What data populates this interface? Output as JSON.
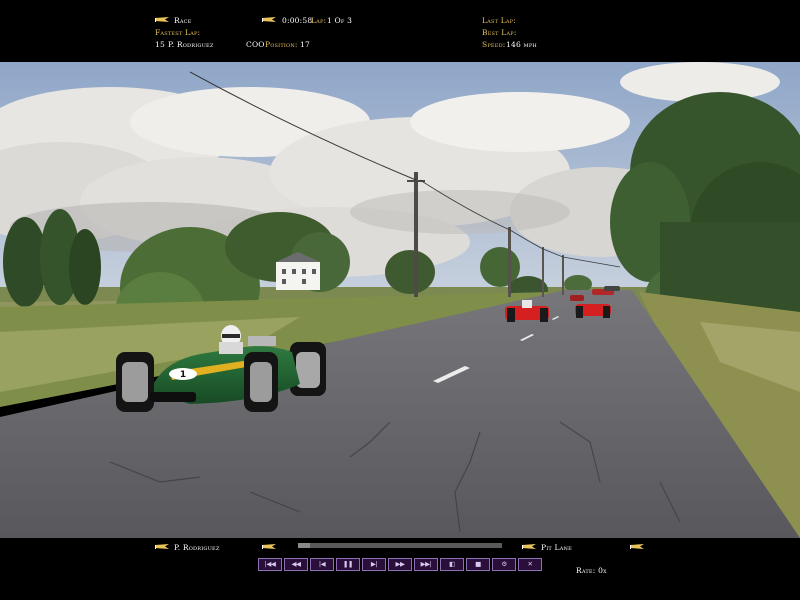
{
  "hud": {
    "session_label": "Race",
    "elapsed_time": "0:00:58",
    "lap_label": "Lap:",
    "lap_value": "1 Of 3",
    "fastest_lap_label": "Fastest Lap:",
    "fastest_lap_number": "15",
    "fastest_lap_driver": "P. Rodriguez",
    "car_code": "COO",
    "position_label": "Position:",
    "position_value": "17",
    "last_lap_label": "Last Lap:",
    "best_lap_label": "Best Lap:",
    "speed_label": "Speed:",
    "speed_value": "146 mph"
  },
  "replay": {
    "driver_name": "P. Rodriguez",
    "camera_label": "Pit Lane",
    "rate_label": "Rate: 0x",
    "progress": 0.06,
    "buttons": [
      {
        "name": "skip-to-start-button",
        "glyph": "|◀◀"
      },
      {
        "name": "rewind-fast-button",
        "glyph": "◀◀"
      },
      {
        "name": "step-back-button",
        "glyph": "|◀"
      },
      {
        "name": "pause-button",
        "glyph": "❚❚"
      },
      {
        "name": "step-forward-button",
        "glyph": "▶|"
      },
      {
        "name": "fast-forward-button",
        "glyph": "▶▶"
      },
      {
        "name": "skip-to-end-button",
        "glyph": "▶▶|"
      },
      {
        "name": "camera-view-button",
        "glyph": "◧"
      },
      {
        "name": "stop-button",
        "glyph": "■"
      },
      {
        "name": "settings-button",
        "glyph": "⚙"
      },
      {
        "name": "exit-button",
        "glyph": "✕"
      }
    ]
  },
  "scene": {
    "player_car_number": "1",
    "colors": {
      "hud_gold": "#e8c35a",
      "player_car": "#1f5a2e",
      "player_car_stripe": "#e0b020",
      "opponent_car": "#d42020",
      "road": "#5e5e62"
    }
  }
}
